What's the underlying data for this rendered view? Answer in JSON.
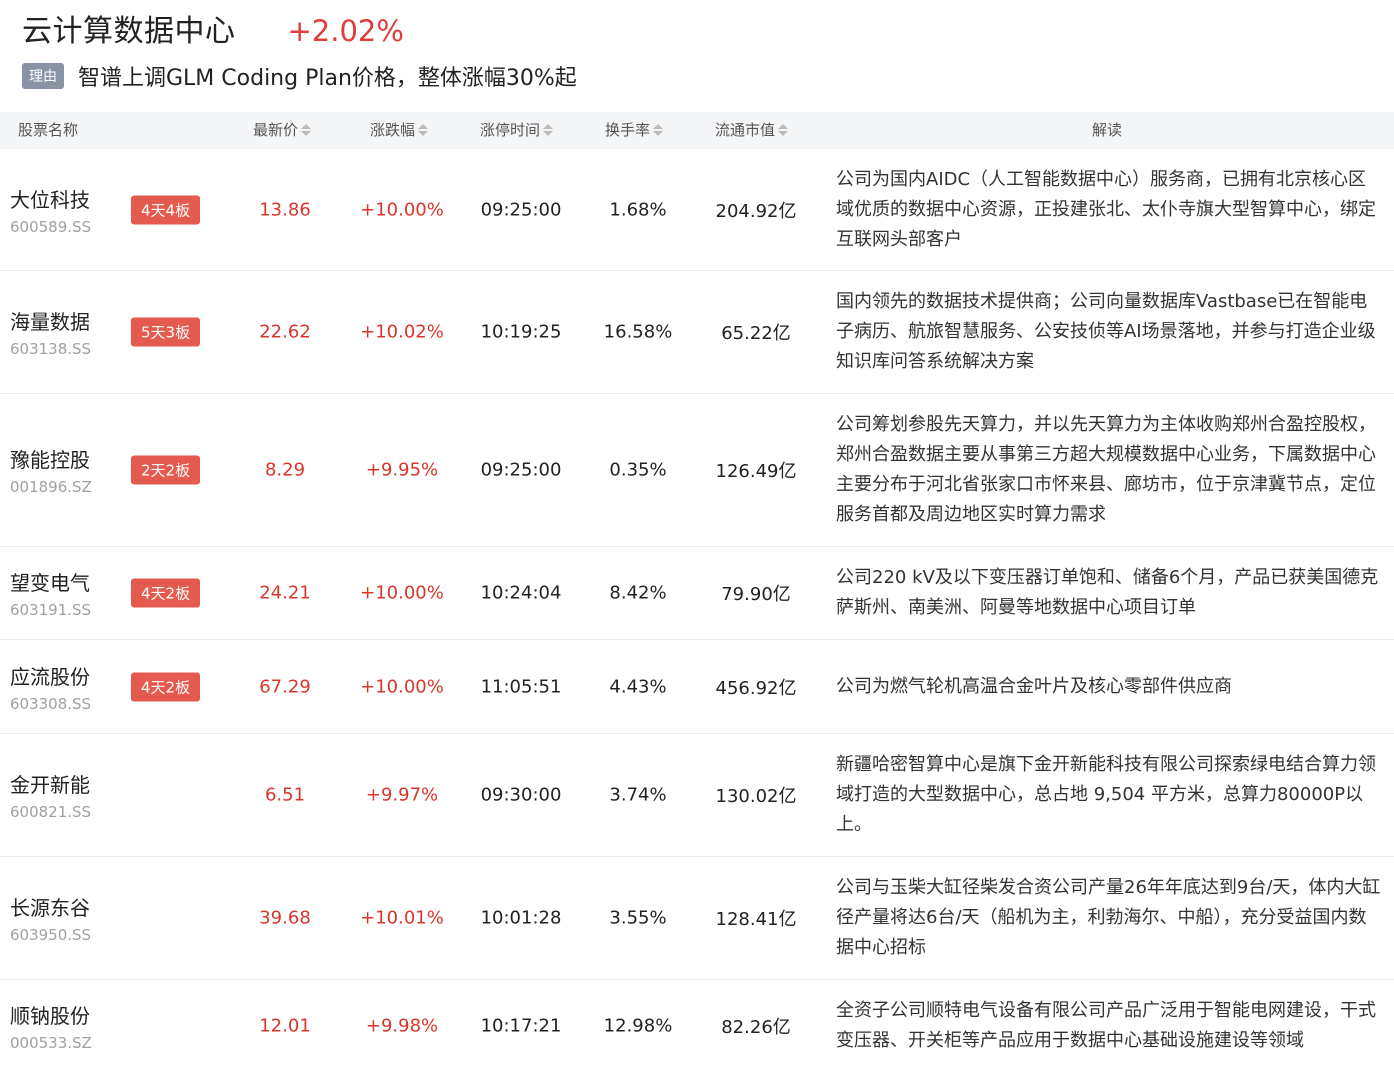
{
  "header": {
    "sector_name": "云计算数据中心",
    "sector_change": "+2.02%",
    "reason_tag": "理由",
    "reason_text": "智谱上调GLM Coding Plan价格，整体涨幅30%起"
  },
  "columns": {
    "name": "股票名称",
    "price": "最新价",
    "change": "涨跌幅",
    "limit_time": "涨停时间",
    "turnover": "换手率",
    "market_cap": "流通市值",
    "interpretation": "解读"
  },
  "rows": [
    {
      "name": "大位科技",
      "code": "600589.SS",
      "badge": "4天4板",
      "price": "13.86",
      "change": "+10.00%",
      "limit_time": "09:25:00",
      "turnover": "1.68%",
      "market_cap": "204.92亿",
      "interpretation": "公司为国内AIDC（人工智能数据中心）服务商，已拥有北京核心区域优质的数据中心资源，正投建张北、太仆寺旗大型智算中心，绑定互联网头部客户"
    },
    {
      "name": "海量数据",
      "code": "603138.SS",
      "badge": "5天3板",
      "price": "22.62",
      "change": "+10.02%",
      "limit_time": "10:19:25",
      "turnover": "16.58%",
      "market_cap": "65.22亿",
      "interpretation": "国内领先的数据技术提供商；公司向量数据库Vastbase已在智能电子病历、航旅智慧服务、公安技侦等AI场景落地，并参与打造企业级知识库问答系统解决方案"
    },
    {
      "name": "豫能控股",
      "code": "001896.SZ",
      "badge": "2天2板",
      "price": "8.29",
      "change": "+9.95%",
      "limit_time": "09:25:00",
      "turnover": "0.35%",
      "market_cap": "126.49亿",
      "interpretation": "公司筹划参股先天算力，并以先天算力为主体收购郑州合盈控股权，郑州合盈数据主要从事第三方超大规模数据中心业务，下属数据中心主要分布于河北省张家口市怀来县、廊坊市，位于京津冀节点，定位服务首都及周边地区实时算力需求"
    },
    {
      "name": "望变电气",
      "code": "603191.SS",
      "badge": "4天2板",
      "price": "24.21",
      "change": "+10.00%",
      "limit_time": "10:24:04",
      "turnover": "8.42%",
      "market_cap": "79.90亿",
      "interpretation": "公司220 kV及以下变压器订单饱和、储备6个月，产品已获美国德克萨斯州、南美洲、阿曼等地数据中心项目订单"
    },
    {
      "name": "应流股份",
      "code": "603308.SS",
      "badge": "4天2板",
      "price": "67.29",
      "change": "+10.00%",
      "limit_time": "11:05:51",
      "turnover": "4.43%",
      "market_cap": "456.92亿",
      "interpretation": "公司为燃气轮机高温合金叶片及核心零部件供应商"
    },
    {
      "name": "金开新能",
      "code": "600821.SS",
      "badge": "",
      "price": "6.51",
      "change": "+9.97%",
      "limit_time": "09:30:00",
      "turnover": "3.74%",
      "market_cap": "130.02亿",
      "interpretation": "新疆哈密智算中心是旗下金开新能科技有限公司探索绿电结合算力领域打造的大型数据中心，总占地 9,504 平方米，总算力80000P以上。"
    },
    {
      "name": "长源东谷",
      "code": "603950.SS",
      "badge": "",
      "price": "39.68",
      "change": "+10.01%",
      "limit_time": "10:01:28",
      "turnover": "3.55%",
      "market_cap": "128.41亿",
      "interpretation": "公司与玉柴大缸径柴发合资公司产量26年年底达到9台/天，体内大缸径产量将达6台/天（船机为主，利勃海尔、中船），充分受益国内数据中心招标"
    },
    {
      "name": "顺钠股份",
      "code": "000533.SZ",
      "badge": "",
      "price": "12.01",
      "change": "+9.98%",
      "limit_time": "10:17:21",
      "turnover": "12.98%",
      "market_cap": "82.26亿",
      "interpretation": "全资子公司顺特电气设备有限公司产品广泛用于智能电网建设，干式变压器、开关柜等产品应用于数据中心基础设施建设等领域"
    }
  ],
  "colors": {
    "up": "#d9362b",
    "badge": "#e55a4f",
    "header_bg": "#f4f5f7",
    "reason_tag_bg": "#8a93a6"
  }
}
